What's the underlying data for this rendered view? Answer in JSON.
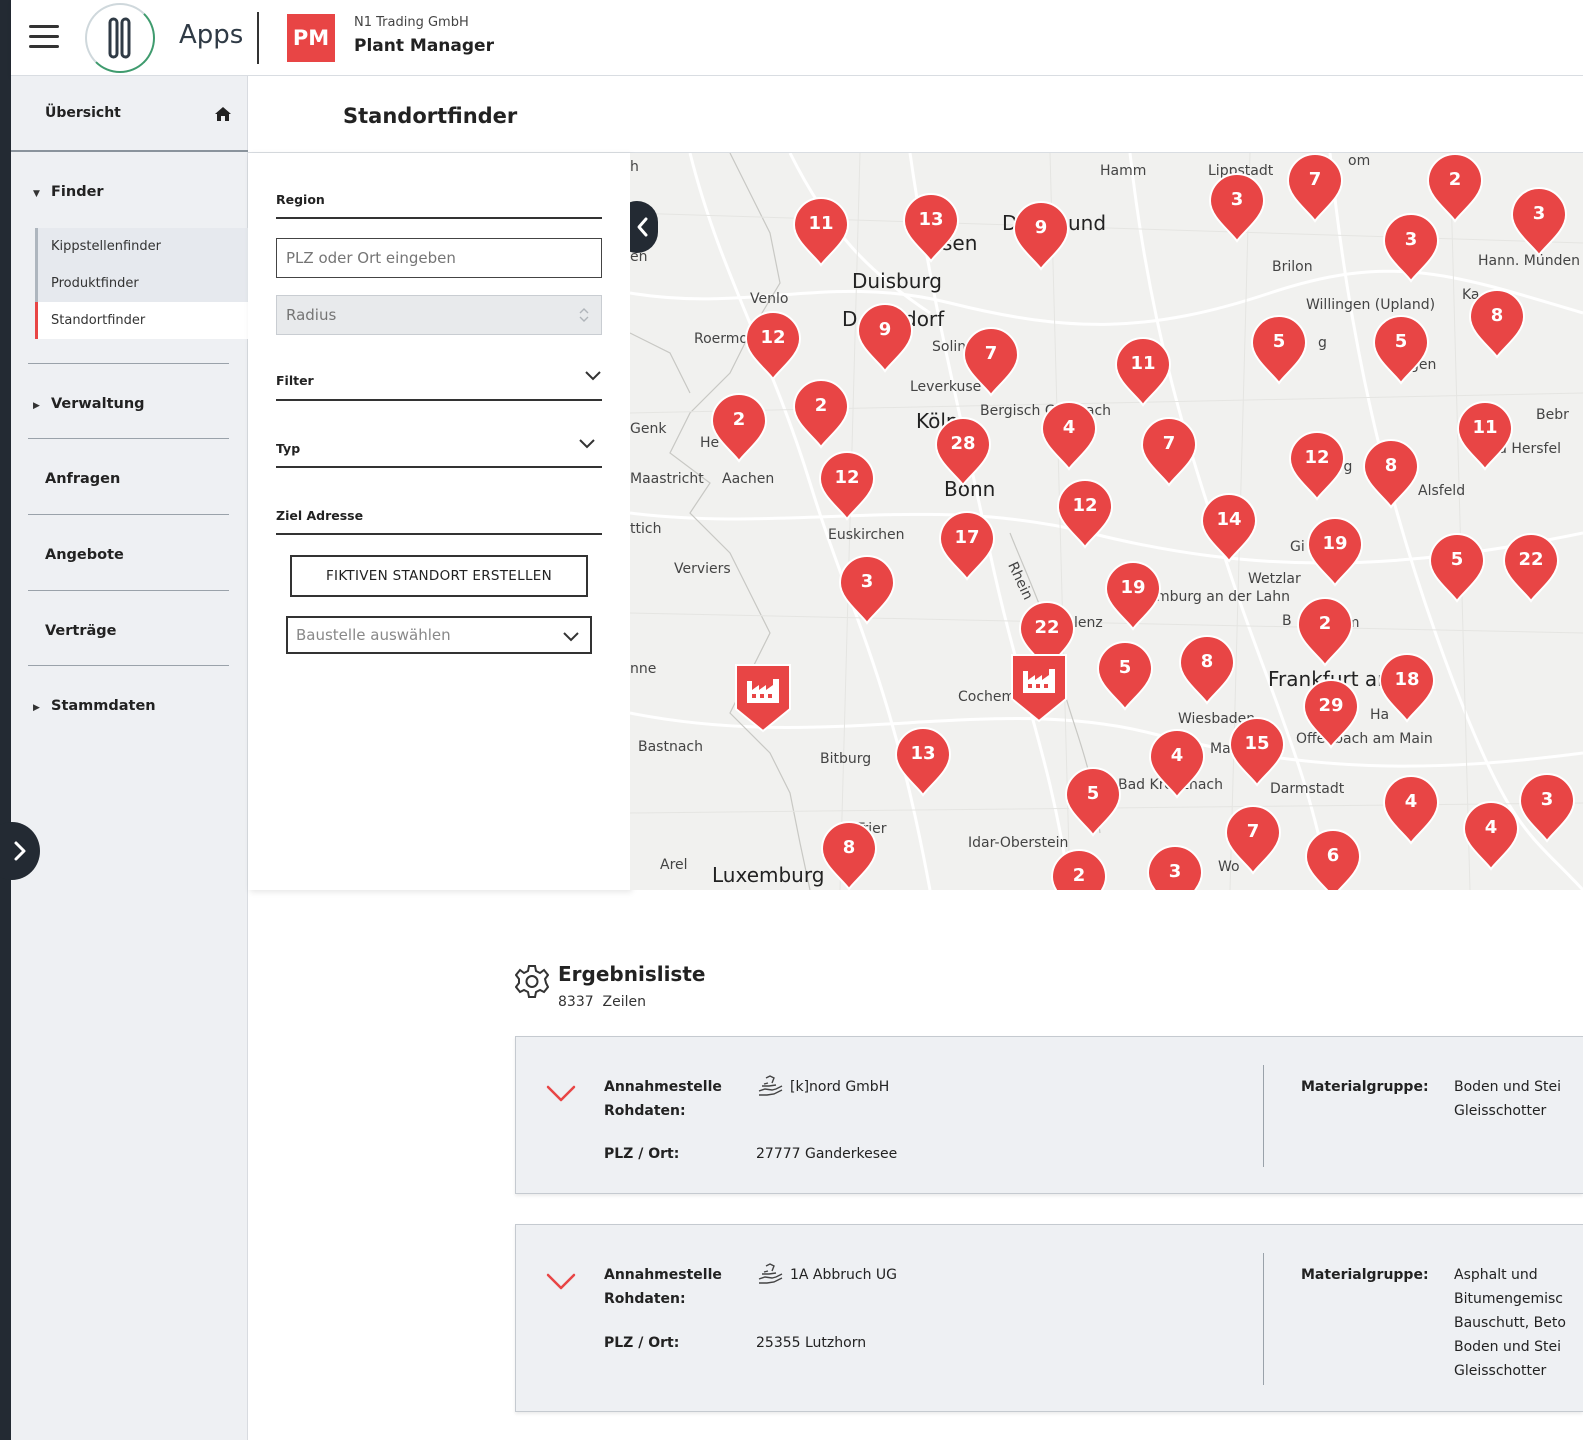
{
  "header": {
    "apps_label": "Apps",
    "badge": "PM",
    "company": "N1 Trading GmbH",
    "app_name": "Plant Manager",
    "menu_icon": "hamburger-icon"
  },
  "sidebar": {
    "overview": "Übersicht",
    "finder": "Finder",
    "sub_items": [
      "Kippstellenfinder",
      "Produktfinder",
      "Standortfinder"
    ],
    "active_sub_item": "Standortfinder",
    "verwaltung": "Verwaltung",
    "anfragen": "Anfragen",
    "angebote": "Angebote",
    "vertraege": "Verträge",
    "stammdaten": "Stammdaten"
  },
  "page": {
    "title": "Standortfinder"
  },
  "filters": {
    "region_label": "Region",
    "region_placeholder": "PLZ oder Ort eingeben",
    "radius_placeholder": "Radius",
    "filter_label": "Filter",
    "typ_label": "Typ",
    "ziel_label": "Ziel Adresse",
    "fictive_button": "FIKTIVEN STANDORT ERSTELLEN",
    "baustelle_placeholder": "Baustelle auswählen"
  },
  "map": {
    "labels": [
      "h",
      "Hamm",
      "Lippstadt",
      "Brilon",
      "Hann. Münden",
      "Willingen (Upland)",
      "Duisburg",
      "Venlo",
      "Roermo",
      "Solin",
      "Leverkuse",
      "Bergisch Gladbach",
      "Köln",
      "Bonn",
      "Maastricht",
      "Aachen",
      "Euskirchen",
      "ttich",
      "Verviers",
      "Genk",
      "He",
      "Alsfeld",
      "Wetzlar",
      "Gi",
      "mburg an der Lahn",
      "lenz",
      "Cochem",
      "Bitburg",
      "Bastnach",
      "nne",
      "Frankfurt am",
      "Wiesbaden",
      "Mai",
      "Offenbach am Main",
      "Darmstadt",
      "Bad Kreuznach",
      "Idar-Oberstein",
      "Trier",
      "Arel",
      "Luxemburg",
      "Wo",
      "Ha",
      "Ka",
      "Bebr",
      "d Hersfel",
      "en",
      "sen",
      "D",
      "dorf",
      "und",
      "D",
      "B",
      "im",
      "rg",
      "gen",
      "om",
      "Rhein",
      "g"
    ],
    "clusters": [
      11,
      13,
      9,
      3,
      7,
      2,
      3,
      3,
      12,
      9,
      7,
      11,
      5,
      5,
      8,
      2,
      2,
      28,
      4,
      7,
      12,
      8,
      11,
      12,
      12,
      14,
      17,
      19,
      5,
      22,
      3,
      19,
      22,
      2,
      5,
      8,
      18,
      29,
      15,
      4,
      13,
      5,
      4,
      7,
      6,
      8,
      2,
      3,
      4,
      3
    ],
    "plant_markers": 2,
    "collapse_icon": "chevron-left-icon"
  },
  "results": {
    "title": "Ergebnisliste",
    "count": "8337",
    "count_unit": "Zeilen",
    "icon": "gear-icon",
    "items": [
      {
        "label_annahme": "Annahmestelle",
        "label_rohdaten": "Rohdaten:",
        "name": "[k]nord GmbH",
        "label_plz": "PLZ / Ort:",
        "plz_ort": "27777 Ganderkesee",
        "label_material": "Materialgruppe:",
        "material_lines": [
          "Boden und Stei",
          "Gleisschotter"
        ]
      },
      {
        "label_annahme": "Annahmestelle",
        "label_rohdaten": "Rohdaten:",
        "name": "1A Abbruch UG",
        "label_plz": "PLZ / Ort:",
        "plz_ort": "25355 Lutzhorn",
        "label_material": "Materialgruppe:",
        "material_lines": [
          "Asphalt und",
          "Bitumengemisc",
          "Bauschutt, Beto",
          "Boden und Stei",
          "Gleisschotter"
        ]
      }
    ]
  },
  "colors": {
    "accent": "#e84545",
    "dark": "#232a33",
    "sidebar_bg": "#eef0f3"
  }
}
